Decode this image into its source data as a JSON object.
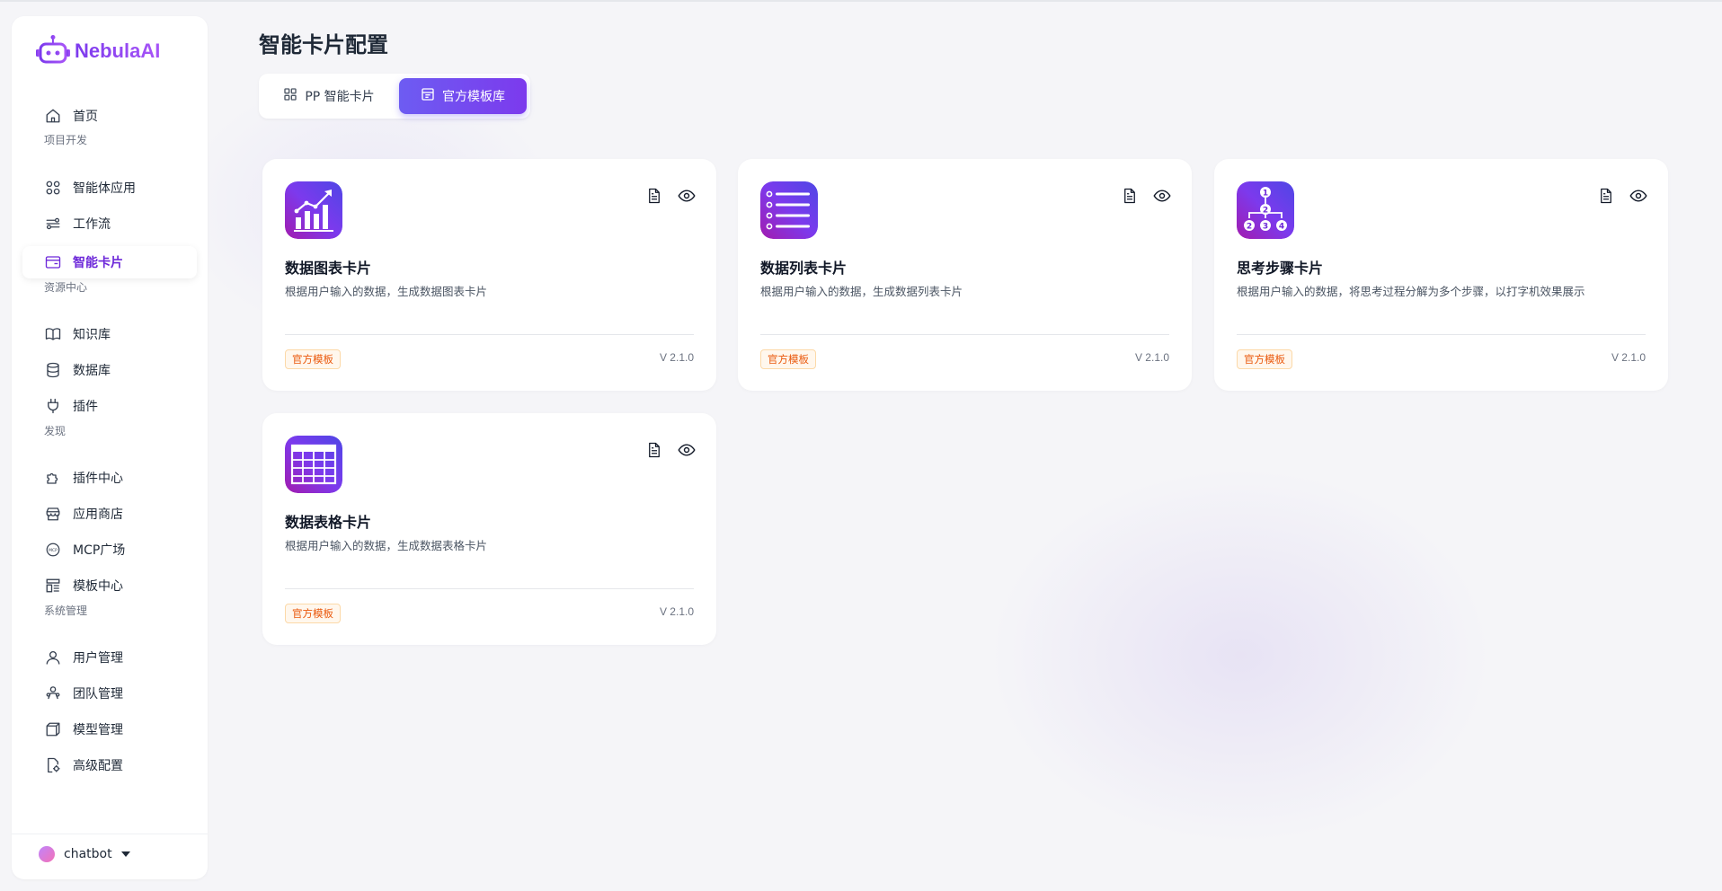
{
  "app": {
    "logo_text": "NebulaAI"
  },
  "sidebar": {
    "home": {
      "label": "首页",
      "icon": "home-icon"
    },
    "sections": [
      {
        "title": "项目开发",
        "items": [
          {
            "label": "智能体应用",
            "icon": "apps-icon"
          },
          {
            "label": "工作流",
            "icon": "workflow-icon"
          },
          {
            "label": "智能卡片",
            "icon": "card-icon",
            "active": true
          }
        ]
      },
      {
        "title": "资源中心",
        "items": [
          {
            "label": "知识库",
            "icon": "book-icon"
          },
          {
            "label": "数据库",
            "icon": "database-icon"
          },
          {
            "label": "插件",
            "icon": "plug-icon"
          }
        ]
      },
      {
        "title": "发现",
        "items": [
          {
            "label": "插件中心",
            "icon": "puzzle-icon"
          },
          {
            "label": "应用商店",
            "icon": "store-icon"
          },
          {
            "label": "MCP广场",
            "icon": "mcp-icon"
          },
          {
            "label": "模板中心",
            "icon": "template-icon"
          }
        ]
      },
      {
        "title": "系统管理",
        "items": [
          {
            "label": "用户管理",
            "icon": "user-icon"
          },
          {
            "label": "团队管理",
            "icon": "team-icon"
          },
          {
            "label": "模型管理",
            "icon": "cube-icon"
          },
          {
            "label": "高级配置",
            "icon": "settings-file-icon"
          }
        ]
      }
    ],
    "user": {
      "name": "chatbot"
    }
  },
  "main": {
    "title": "智能卡片配置",
    "tabs": [
      {
        "label": "PP 智能卡片",
        "icon": "grid-icon",
        "active": false
      },
      {
        "label": "官方模板库",
        "icon": "template-store-icon",
        "active": true
      }
    ],
    "cards": [
      {
        "title": "数据图表卡片",
        "description": "根据用户输入的数据，生成数据图表卡片",
        "badge": "官方模板",
        "version": "V 2.1.0",
        "icon": "bar-chart-icon"
      },
      {
        "title": "数据列表卡片",
        "description": "根据用户输入的数据，生成数据列表卡片",
        "badge": "官方模板",
        "version": "V 2.1.0",
        "icon": "list-icon"
      },
      {
        "title": "思考步骤卡片",
        "description": "根据用户输入的数据，将思考过程分解为多个步骤，以打字机效果展示",
        "badge": "官方模板",
        "version": "V 2.1.0",
        "icon": "steps-tree-icon"
      },
      {
        "title": "数据表格卡片",
        "description": "根据用户输入的数据，生成数据表格卡片",
        "badge": "官方模板",
        "version": "V 2.1.0",
        "icon": "table-icon"
      }
    ]
  },
  "colors": {
    "accent": "#7c3aed",
    "tab_active_start": "#6d5cf2",
    "badge_text": "#ea580c",
    "badge_bg": "#fff7ed",
    "page_bg": "#f5f5f8"
  }
}
